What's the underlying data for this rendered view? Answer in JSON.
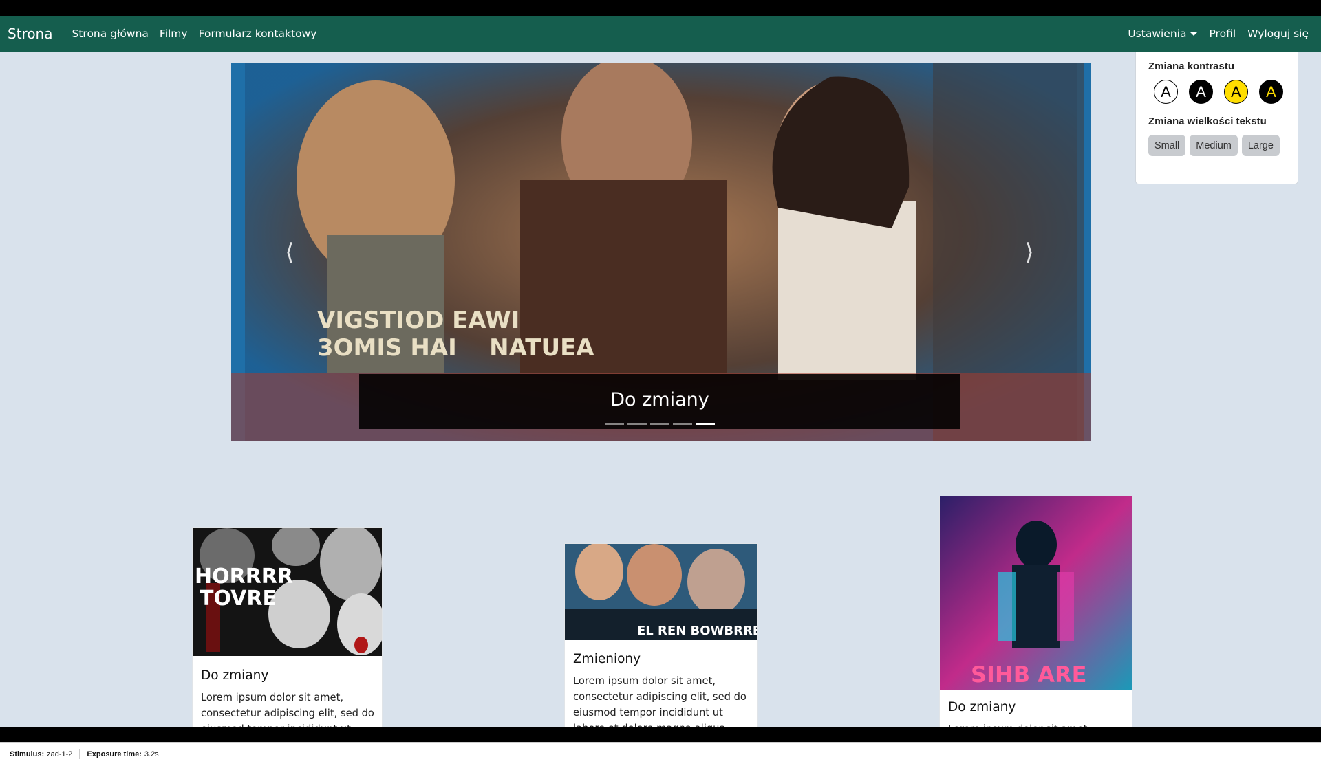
{
  "navbar": {
    "brand": "Strona",
    "links": [
      "Strona główna",
      "Filmy",
      "Formularz kontaktowy"
    ],
    "right": {
      "settings": "Ustawienia",
      "profile": "Profil",
      "logout": "Wyloguj się"
    }
  },
  "settings_menu": {
    "contrast_heading": "Zmiana kontrastu",
    "contrast_options": [
      "A",
      "A",
      "A",
      "A"
    ],
    "text_size_heading": "Zmiana wielkości tekstu",
    "size_options": [
      "Small",
      "Medium",
      "Large"
    ]
  },
  "carousel": {
    "caption": "Do zmiany",
    "poster_text_line1": "VIGSTIOD EAWI",
    "poster_text_line2": "3OMIS HAI    NATUEA",
    "slide_count": 5,
    "active_slide": 5
  },
  "cards": [
    {
      "title": "Do zmiany",
      "text": "Lorem ipsum dolor sit amet, consectetur adipiscing elit, sed do eiusmod tempor incididunt ut",
      "poster_text": [
        "HORRRR",
        "TOVRE"
      ]
    },
    {
      "title": "Zmieniony",
      "text": "Lorem ipsum dolor sit amet, consectetur adipiscing elit, sed do eiusmod tempor incididunt ut labore et dolore magna aliqua",
      "poster_text": [
        "EL REN BOWBRREB"
      ]
    },
    {
      "title": "Do zmiany",
      "text": "Lorem ipsum dolor sit amet",
      "poster_text": [
        "SIHB ARE"
      ]
    }
  ],
  "status_bar": {
    "stimulus_label": "Stimulus:",
    "stimulus_value": "zad-1-2",
    "exposure_label": "Exposure time:",
    "exposure_value": "3.2s"
  }
}
